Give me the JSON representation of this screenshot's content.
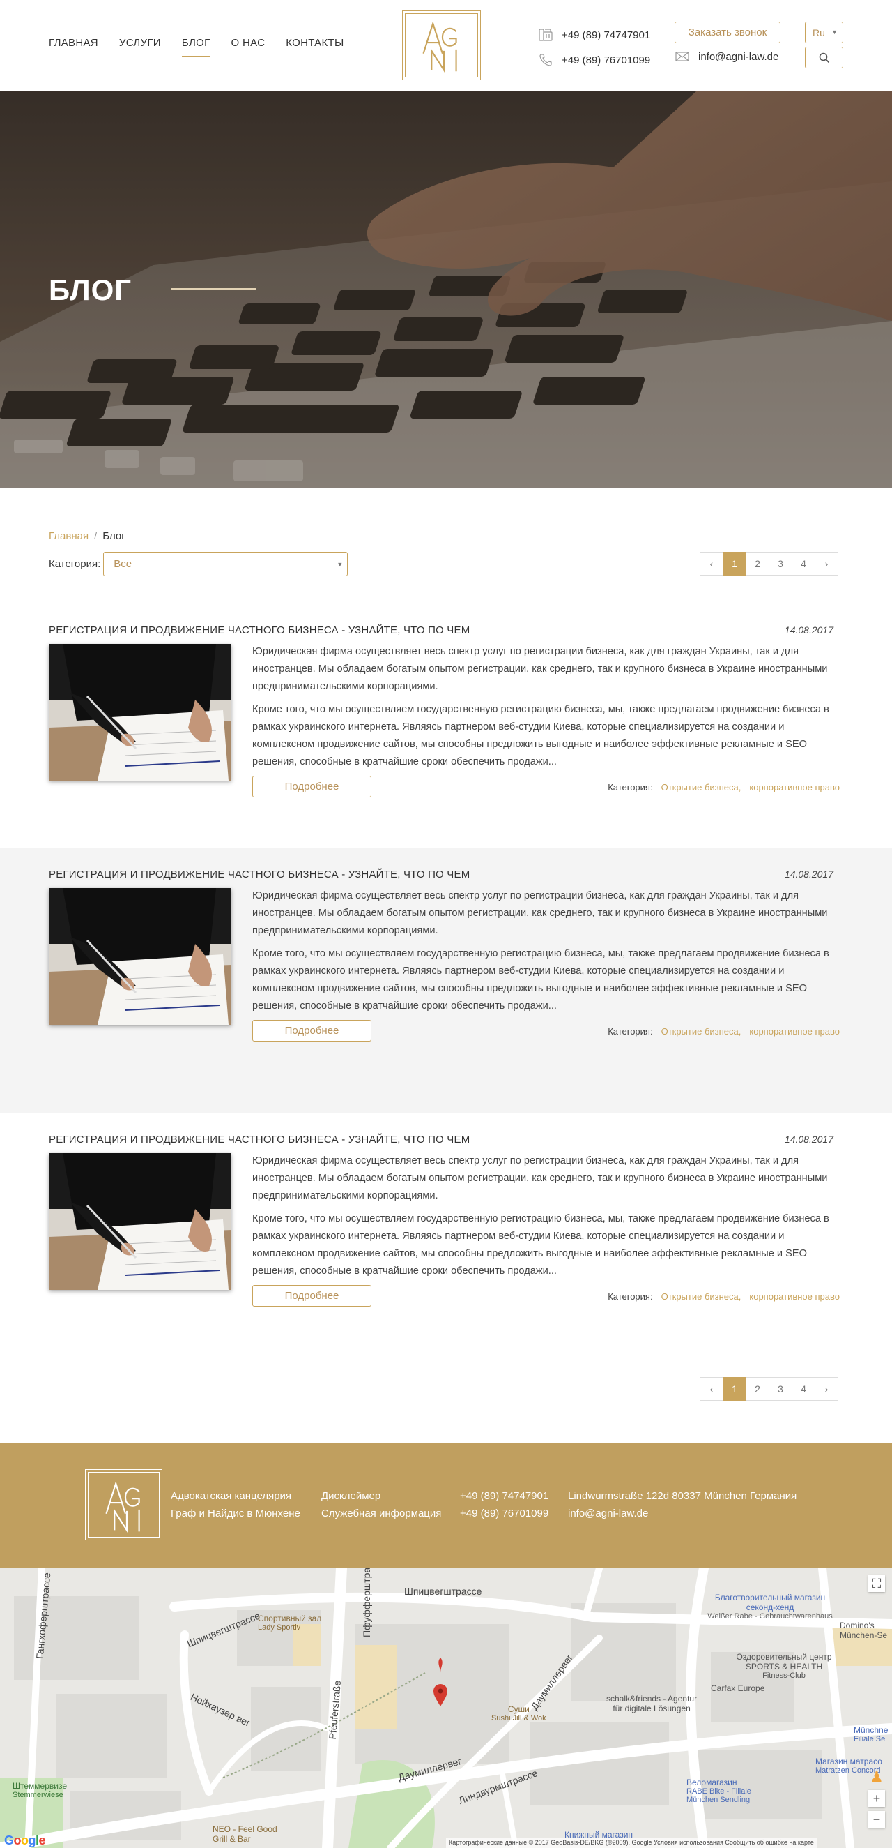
{
  "header": {
    "nav": [
      "ГЛАВНАЯ",
      "УСЛУГИ",
      "БЛОГ",
      "О НАС",
      "КОНТАКТЫ"
    ],
    "phone1": "+49 (89) 74747901",
    "phone2": "+49 (89) 76701099",
    "call_button": "Заказать звонок",
    "email": "info@agni-law.de",
    "language": "Ru",
    "logo_letters": "AGNI"
  },
  "hero": {
    "title": "БЛОГ"
  },
  "breadcrumb": {
    "home": "Главная",
    "separator": "/",
    "current": "Блог"
  },
  "filter": {
    "label": "Категория:",
    "value": "Все"
  },
  "pagination": {
    "prev": "‹",
    "pages": [
      "1",
      "2",
      "3",
      "4"
    ],
    "next": "›",
    "active": "1"
  },
  "posts": [
    {
      "title": "РЕГИСТРАЦИЯ И ПРОДВИЖЕНИЕ ЧАСТНОГО БИЗНЕСА - УЗНАЙТЕ, ЧТО ПО ЧЕМ",
      "date": "14.08.2017",
      "p1": "Юридическая фирма осуществляет весь спектр услуг по регистрации бизнеса, как для граждан Украины, так и для иностранцев. Мы обладаем богатым опытом регистрации, как среднего, так и крупного бизнеса в Украине иностранными предпринимательскими корпорациями.",
      "p2": "Кроме того, что мы осуществляем государственную регистрацию бизнеса, мы, также предлагаем продвижение бизнеса в рамках украинского интернета. Являясь партнером веб-студии Киева, которые специализируется на создании и комплексном продвижение сайтов, мы способны предложить выгодные и наиболее эффективные рекламные и SEO решения, способные в кратчайшие сроки обеспечить продажи...",
      "more": "Подробнее",
      "category_label": "Категория:",
      "categories": [
        "Открытие бизнеса,",
        "корпоративное право"
      ]
    },
    {
      "title": "РЕГИСТРАЦИЯ И ПРОДВИЖЕНИЕ ЧАСТНОГО БИЗНЕСА - УЗНАЙТЕ, ЧТО ПО ЧЕМ",
      "date": "14.08.2017",
      "p1": "Юридическая фирма осуществляет весь спектр услуг по регистрации бизнеса, как для граждан Украины, так и для иностранцев. Мы обладаем богатым опытом регистрации, как среднего, так и крупного бизнеса в Украине иностранными предпринимательскими корпорациями.",
      "p2": "Кроме того, что мы осуществляем государственную регистрацию бизнеса, мы, также предлагаем продвижение бизнеса в рамках украинского интернета. Являясь партнером веб-студии Киева, которые специализируется на создании и комплексном продвижение сайтов, мы способны предложить выгодные и наиболее эффективные рекламные и SEO решения, способные в кратчайшие сроки обеспечить продажи...",
      "more": "Подробнее",
      "category_label": "Категория:",
      "categories": [
        "Открытие бизнеса,",
        "корпоративное право"
      ]
    },
    {
      "title": "РЕГИСТРАЦИЯ И ПРОДВИЖЕНИЕ ЧАСТНОГО БИЗНЕСА - УЗНАЙТЕ, ЧТО ПО ЧЕМ",
      "date": "14.08.2017",
      "p1": "Юридическая фирма осуществляет весь спектр услуг по регистрации бизнеса, как для граждан Украины, так и для иностранцев. Мы обладаем богатым опытом регистрации, как среднего, так и крупного бизнеса в Украине иностранными предпринимательскими корпорациями.",
      "p2": "Кроме того, что мы осуществляем государственную регистрацию бизнеса, мы, также предлагаем продвижение бизнеса в рамках украинского интернета. Являясь партнером веб-студии Киева, которые специализируется на создании и комплексном продвижение сайтов, мы способны предложить выгодные и наиболее эффективные рекламные и SEO решения, способные в кратчайшие сроки обеспечить продажи...",
      "more": "Подробнее",
      "category_label": "Категория:",
      "categories": [
        "Открытие бизнеса,",
        "корпоративное право"
      ]
    }
  ],
  "footer": {
    "col1": [
      "Адвокатская канцелярия",
      "Граф и Найдис в Мюнхене"
    ],
    "col2": [
      "Дисклеймер",
      "Служебная информация"
    ],
    "col3": [
      "+49 (89) 74747901",
      "+49 (89) 76701099"
    ],
    "col4": [
      "Lindwurmstraße 122d 80337 München Германия",
      "info@agni-law.de"
    ]
  },
  "map": {
    "streets": [
      "Шпицвегштрассе",
      "Шпицвегштрассе",
      "Пфуфферштрассе",
      "Pfeuferstraße",
      "Нойхаузер вег",
      "Даумиллервег",
      "Даумиллервег",
      "Линдвурмштрассе",
      "Гангхоферштрассе"
    ],
    "places": [
      {
        "name": "Спортивный зал",
        "sub": "Lady Sportiv"
      },
      {
        "name": "Благотворительный магазин секонд-хенд",
        "sub": "Weißer Rabe - Gebrauchtwarenhaus"
      },
      {
        "name": "Оздоровительный центр SPORTS & HEALTH",
        "sub": "Fitness-Club"
      },
      {
        "name": "Carfax Europe",
        "sub": ""
      },
      {
        "name": "schalk&friends - Agentur",
        "sub": "für digitale Lösungen"
      },
      {
        "name": "Суши",
        "sub": "Sushi Jill & Wok"
      },
      {
        "name": "Веломагазин",
        "sub": "RABE Bike - Filiale München Sendling"
      },
      {
        "name": "Книжный магазин",
        "sub": ""
      },
      {
        "name": "Штеммервизе",
        "sub": "Stemmerwiese"
      },
      {
        "name": "NEO - Feel Good",
        "sub": "Grill & Bar"
      },
      {
        "name": "Domino's",
        "sub": "München-Se"
      },
      {
        "name": "Магазин матрасо",
        "sub": "Matratzen Concord"
      },
      {
        "name": "Münchne",
        "sub": "Filiale Se"
      }
    ],
    "google": "Google",
    "attribution": "Картографические данные © 2017 GeoBasis-DE/BKG (©2009), Google   Условия использования   Сообщить об ошибке на карте"
  },
  "colors": {
    "accent": "#c9a45c",
    "footer_bg": "#c09f5f",
    "gray_bg": "#f4f4f4"
  }
}
